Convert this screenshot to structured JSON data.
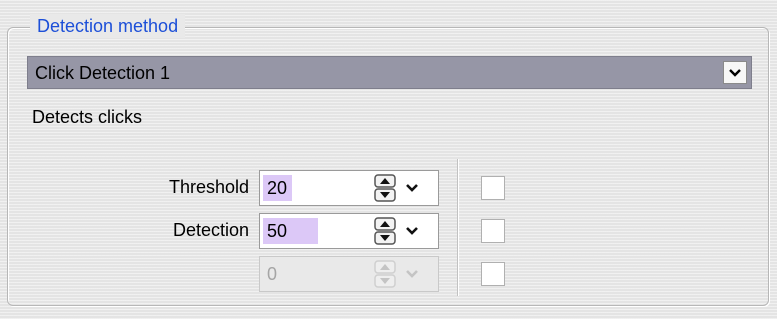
{
  "group": {
    "title": "Detection method"
  },
  "method_select": {
    "selected": "Click Detection 1",
    "arrow_icon": "chevron-down-icon"
  },
  "description": "Detects clicks",
  "params": [
    {
      "label": "Threshold",
      "value": "20",
      "enabled": true
    },
    {
      "label": "Detection",
      "value": "50",
      "enabled": true
    },
    {
      "label": "",
      "value": "0",
      "enabled": false
    }
  ],
  "colors": {
    "title": "#1c4fd8",
    "select_background": "#9696a6",
    "selection_highlight": "#dcc8f7"
  }
}
